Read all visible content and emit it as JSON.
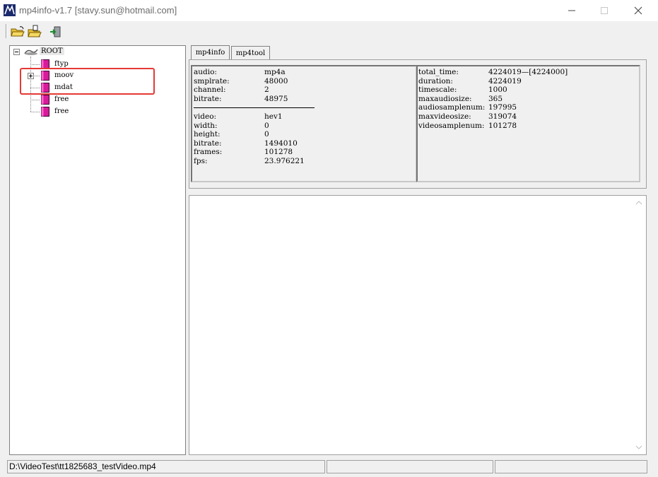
{
  "window": {
    "title": "mp4info-v1.7 [stavy.sun@hotmail.com]",
    "controls": [
      "minimize",
      "maximize",
      "close"
    ]
  },
  "toolbar": {
    "buttons": [
      {
        "icon": "open-folder-icon"
      },
      {
        "icon": "open-file-icon"
      },
      {
        "icon": "exit-icon"
      }
    ]
  },
  "tree": {
    "root": "ROOT",
    "items": [
      {
        "label": "ftyp"
      },
      {
        "label": "moov",
        "expandable": true
      },
      {
        "label": "mdat"
      },
      {
        "label": "free"
      },
      {
        "label": "free"
      }
    ]
  },
  "tabs": [
    {
      "label": "mp4info",
      "active": true
    },
    {
      "label": "mp4tool",
      "active": false
    }
  ],
  "audio_info": [
    {
      "key": "audio:",
      "value": "mp4a"
    },
    {
      "key": "smplrate:",
      "value": "48000"
    },
    {
      "key": "channel:",
      "value": "2"
    },
    {
      "key": "bitrate:",
      "value": "48975"
    }
  ],
  "video_info": [
    {
      "key": "video:",
      "value": "hev1"
    },
    {
      "key": "width:",
      "value": "0"
    },
    {
      "key": "height:",
      "value": "0"
    },
    {
      "key": "bitrate:",
      "value": "1494010"
    },
    {
      "key": "frames:",
      "value": "101278"
    },
    {
      "key": "fps:",
      "value": "23.976221"
    }
  ],
  "time_info": [
    {
      "key": "total_time:",
      "value": "4224019—[4224000]"
    },
    {
      "key": "duration:",
      "value": "4224019"
    },
    {
      "key": "timescale:",
      "value": "1000"
    },
    {
      "key": "maxaudiosize:",
      "value": "365"
    },
    {
      "key": "audiosamplenum:",
      "value": "197995"
    },
    {
      "key": "maxvideosize:",
      "value": "319074"
    },
    {
      "key": "videosamplenum:",
      "value": "101278"
    }
  ],
  "status": {
    "path": "D:\\VideoTest\\tt1825683_testVideo.mp4",
    "pane2": "",
    "pane3": ""
  },
  "colors": {
    "highlight": "#e53935",
    "folder": "#d81b9a"
  }
}
